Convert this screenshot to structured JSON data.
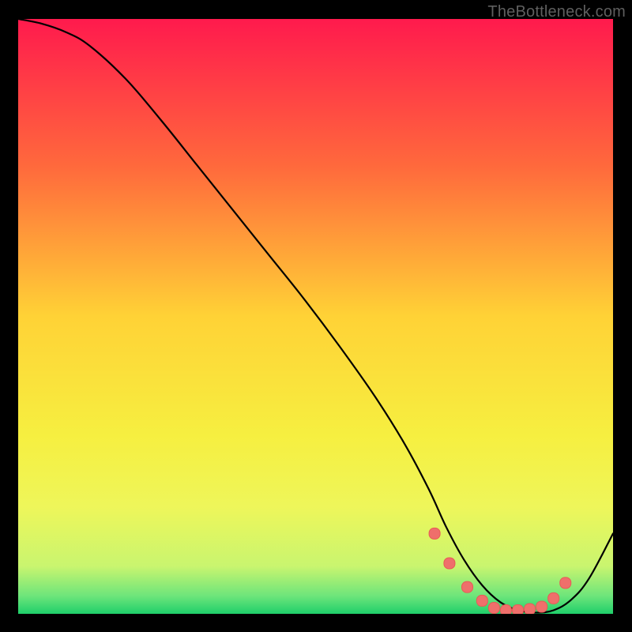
{
  "watermark": "TheBottleneck.com",
  "chart_data": {
    "type": "line",
    "title": "",
    "xlabel": "",
    "ylabel": "",
    "xlim": [
      0,
      100
    ],
    "ylim": [
      0,
      100
    ],
    "grid": false,
    "legend": false,
    "gradient_stops": [
      {
        "offset": 0,
        "color": "#ff1a4d"
      },
      {
        "offset": 0.25,
        "color": "#ff6a3c"
      },
      {
        "offset": 0.5,
        "color": "#ffd236"
      },
      {
        "offset": 0.7,
        "color": "#f6ef40"
      },
      {
        "offset": 0.82,
        "color": "#eef65a"
      },
      {
        "offset": 0.92,
        "color": "#c9f56f"
      },
      {
        "offset": 0.97,
        "color": "#6de57b"
      },
      {
        "offset": 1.0,
        "color": "#1fcf6a"
      }
    ],
    "series": [
      {
        "name": "curve",
        "color": "#000000",
        "stroke_width": 2.2,
        "x": [
          0,
          4,
          8,
          12,
          18,
          24,
          30,
          36,
          42,
          48,
          54,
          60,
          65,
          69,
          72,
          75,
          78,
          81,
          84,
          87,
          90,
          93,
          96,
          100
        ],
        "y": [
          100,
          99.2,
          97.8,
          95.5,
          90.0,
          83.0,
          75.5,
          68.0,
          60.5,
          53.0,
          45.0,
          36.5,
          28.5,
          21.0,
          14.5,
          9.0,
          4.8,
          2.0,
          0.6,
          0.2,
          0.6,
          2.4,
          6.0,
          13.5
        ]
      }
    ],
    "markers": {
      "name": "dots",
      "shape": "rounded-square",
      "color": "#ef6f6b",
      "stroke": "#e85a56",
      "size": 14,
      "x": [
        70,
        72.5,
        75.5,
        78,
        80,
        82,
        84,
        86,
        88,
        90,
        92
      ],
      "y": [
        13.5,
        8.5,
        4.5,
        2.2,
        1.0,
        0.6,
        0.6,
        0.8,
        1.2,
        2.6,
        5.2
      ]
    }
  }
}
